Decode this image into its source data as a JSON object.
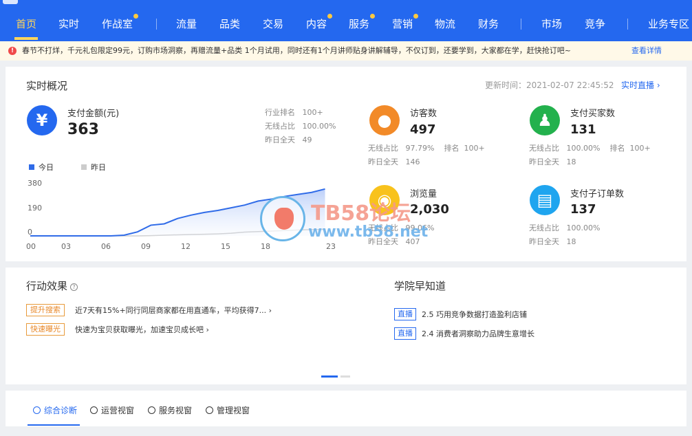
{
  "nav": {
    "items": [
      {
        "label": "首页",
        "active": true,
        "dot": false
      },
      {
        "label": "实时",
        "active": false,
        "dot": false
      },
      {
        "label": "作战室",
        "active": false,
        "dot": true
      },
      {
        "label": "流量",
        "active": false,
        "dot": false
      },
      {
        "label": "品类",
        "active": false,
        "dot": false
      },
      {
        "label": "交易",
        "active": false,
        "dot": false
      },
      {
        "label": "内容",
        "active": false,
        "dot": true
      },
      {
        "label": "服务",
        "active": false,
        "dot": true
      },
      {
        "label": "营销",
        "active": false,
        "dot": true
      },
      {
        "label": "物流",
        "active": false,
        "dot": false
      },
      {
        "label": "财务",
        "active": false,
        "dot": false
      },
      {
        "label": "市场",
        "active": false,
        "dot": false
      },
      {
        "label": "竞争",
        "active": false,
        "dot": false
      },
      {
        "label": "业务专区",
        "active": false,
        "dot": false
      }
    ]
  },
  "notice": {
    "icon": "warning-icon",
    "text": "春节不打烊，千元礼包限定99元，订购市场洞察，再赠流量+品类 1个月试用，同时还有1个月讲师贴身讲解辅导，不仅订到，还要学到，大家都在学，赶快抢订吧~",
    "link": "查看详情"
  },
  "realtime": {
    "title": "实时概况",
    "update_label": "更新时间：",
    "update_time": "2021-02-07 22:45:52",
    "live_link": "实时直播",
    "payment": {
      "icon": "yuan-icon",
      "label": "支付金额(元)",
      "value": "363",
      "rank_label": "行业排名",
      "rank_value": "100+",
      "wireless_label": "无线占比",
      "wireless_value": "100.00%",
      "yesterday_label": "昨日全天",
      "yesterday_value": "49"
    },
    "visitors": {
      "icon": "paw-icon",
      "label": "访客数",
      "value": "497",
      "wireless_label": "无线占比",
      "wireless_value": "97.79%",
      "rank_label": "排名",
      "rank_value": "100+",
      "yesterday_label": "昨日全天",
      "yesterday_value": "146"
    },
    "buyers": {
      "icon": "users-icon",
      "label": "支付买家数",
      "value": "131",
      "wireless_label": "无线占比",
      "wireless_value": "100.00%",
      "rank_label": "排名",
      "rank_value": "100+",
      "yesterday_label": "昨日全天",
      "yesterday_value": "18"
    },
    "pageviews": {
      "icon": "eye-icon",
      "label": "浏览量",
      "value": "2,030",
      "wireless_label": "无线占比",
      "wireless_value": "99.06%",
      "yesterday_label": "昨日全天",
      "yesterday_value": "407"
    },
    "orders": {
      "icon": "clipboard-icon",
      "label": "支付子订单数",
      "value": "137",
      "wireless_label": "无线占比",
      "wireless_value": "100.00%",
      "yesterday_label": "昨日全天",
      "yesterday_value": "18"
    }
  },
  "chart_data": {
    "type": "area",
    "x": [
      0,
      1,
      2,
      3,
      4,
      5,
      6,
      7,
      8,
      9,
      10,
      11,
      12,
      13,
      14,
      15,
      16,
      17,
      18,
      19,
      20,
      21,
      22,
      23
    ],
    "xticks": [
      "00",
      "03",
      "06",
      "09",
      "12",
      "15",
      "18",
      "23"
    ],
    "yticks": [
      "380",
      "190",
      "0"
    ],
    "ylim": [
      0,
      380
    ],
    "xlim": [
      0,
      23
    ],
    "series": [
      {
        "name": "今日",
        "color": "#2f6be8",
        "values": [
          0,
          0,
          0,
          0,
          0,
          0,
          0,
          5,
          30,
          80,
          90,
          130,
          155,
          175,
          190,
          210,
          230,
          260,
          275,
          295,
          310,
          325,
          350,
          null
        ]
      },
      {
        "name": "昨日",
        "color": "#cccccc",
        "values": [
          0,
          0,
          0,
          0,
          0,
          0,
          0,
          0,
          0,
          2,
          5,
          8,
          10,
          12,
          15,
          20,
          28,
          32,
          36,
          40,
          44,
          47,
          49,
          null
        ]
      }
    ],
    "legend": "top-left"
  },
  "actions": {
    "title": "行动效果",
    "items": [
      {
        "tag": "提升搜索",
        "text": "近7天有15%+同行同层商家都在用直通车，平均获得7..."
      },
      {
        "tag": "快速曝光",
        "text": "快速为宝贝获取曝光，加速宝贝成长吧"
      }
    ]
  },
  "academy": {
    "title": "学院早知道",
    "items": [
      {
        "tag": "直播",
        "text": "2.5 巧用竞争数据打造盈利店铺"
      },
      {
        "tag": "直播",
        "text": "2.4 消费者洞察助力品牌生意增长"
      }
    ]
  },
  "tabs": [
    {
      "label": "综合诊断",
      "icon": "diagnosis-icon",
      "active": true
    },
    {
      "label": "运营视窗",
      "icon": "operation-icon",
      "active": false
    },
    {
      "label": "服务视窗",
      "icon": "headset-icon",
      "active": false
    },
    {
      "label": "管理视窗",
      "icon": "manage-icon",
      "active": false
    }
  ],
  "watermark": {
    "title": "TB58论坛",
    "url": "www.tb58.net"
  },
  "colors": {
    "brand": "#2468ef",
    "accent": "#ffd65c",
    "orange": "#f28a28",
    "green": "#23b14d",
    "yellow": "#f8c21c",
    "cyan": "#1fa5ef"
  }
}
